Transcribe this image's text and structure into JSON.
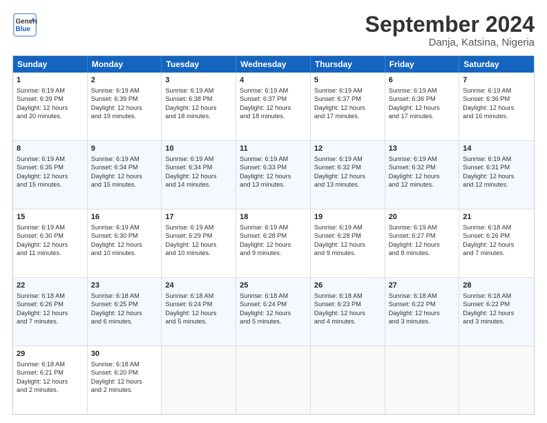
{
  "header": {
    "logo_line1": "General",
    "logo_line2": "Blue",
    "title": "September 2024",
    "subtitle": "Danja, Katsina, Nigeria"
  },
  "days": [
    "Sunday",
    "Monday",
    "Tuesday",
    "Wednesday",
    "Thursday",
    "Friday",
    "Saturday"
  ],
  "rows": [
    [
      {
        "num": "1",
        "lines": [
          "Sunrise: 6:19 AM",
          "Sunset: 6:39 PM",
          "Daylight: 12 hours",
          "and 20 minutes."
        ]
      },
      {
        "num": "2",
        "lines": [
          "Sunrise: 6:19 AM",
          "Sunset: 6:39 PM",
          "Daylight: 12 hours",
          "and 19 minutes."
        ]
      },
      {
        "num": "3",
        "lines": [
          "Sunrise: 6:19 AM",
          "Sunset: 6:38 PM",
          "Daylight: 12 hours",
          "and 18 minutes."
        ]
      },
      {
        "num": "4",
        "lines": [
          "Sunrise: 6:19 AM",
          "Sunset: 6:37 PM",
          "Daylight: 12 hours",
          "and 18 minutes."
        ]
      },
      {
        "num": "5",
        "lines": [
          "Sunrise: 6:19 AM",
          "Sunset: 6:37 PM",
          "Daylight: 12 hours",
          "and 17 minutes."
        ]
      },
      {
        "num": "6",
        "lines": [
          "Sunrise: 6:19 AM",
          "Sunset: 6:36 PM",
          "Daylight: 12 hours",
          "and 17 minutes."
        ]
      },
      {
        "num": "7",
        "lines": [
          "Sunrise: 6:19 AM",
          "Sunset: 6:36 PM",
          "Daylight: 12 hours",
          "and 16 minutes."
        ]
      }
    ],
    [
      {
        "num": "8",
        "lines": [
          "Sunrise: 6:19 AM",
          "Sunset: 6:35 PM",
          "Daylight: 12 hours",
          "and 15 minutes."
        ]
      },
      {
        "num": "9",
        "lines": [
          "Sunrise: 6:19 AM",
          "Sunset: 6:34 PM",
          "Daylight: 12 hours",
          "and 15 minutes."
        ]
      },
      {
        "num": "10",
        "lines": [
          "Sunrise: 6:19 AM",
          "Sunset: 6:34 PM",
          "Daylight: 12 hours",
          "and 14 minutes."
        ]
      },
      {
        "num": "11",
        "lines": [
          "Sunrise: 6:19 AM",
          "Sunset: 6:33 PM",
          "Daylight: 12 hours",
          "and 13 minutes."
        ]
      },
      {
        "num": "12",
        "lines": [
          "Sunrise: 6:19 AM",
          "Sunset: 6:32 PM",
          "Daylight: 12 hours",
          "and 13 minutes."
        ]
      },
      {
        "num": "13",
        "lines": [
          "Sunrise: 6:19 AM",
          "Sunset: 6:32 PM",
          "Daylight: 12 hours",
          "and 12 minutes."
        ]
      },
      {
        "num": "14",
        "lines": [
          "Sunrise: 6:19 AM",
          "Sunset: 6:31 PM",
          "Daylight: 12 hours",
          "and 12 minutes."
        ]
      }
    ],
    [
      {
        "num": "15",
        "lines": [
          "Sunrise: 6:19 AM",
          "Sunset: 6:30 PM",
          "Daylight: 12 hours",
          "and 11 minutes."
        ]
      },
      {
        "num": "16",
        "lines": [
          "Sunrise: 6:19 AM",
          "Sunset: 6:30 PM",
          "Daylight: 12 hours",
          "and 10 minutes."
        ]
      },
      {
        "num": "17",
        "lines": [
          "Sunrise: 6:19 AM",
          "Sunset: 6:29 PM",
          "Daylight: 12 hours",
          "and 10 minutes."
        ]
      },
      {
        "num": "18",
        "lines": [
          "Sunrise: 6:19 AM",
          "Sunset: 6:28 PM",
          "Daylight: 12 hours",
          "and 9 minutes."
        ]
      },
      {
        "num": "19",
        "lines": [
          "Sunrise: 6:19 AM",
          "Sunset: 6:28 PM",
          "Daylight: 12 hours",
          "and 9 minutes."
        ]
      },
      {
        "num": "20",
        "lines": [
          "Sunrise: 6:19 AM",
          "Sunset: 6:27 PM",
          "Daylight: 12 hours",
          "and 8 minutes."
        ]
      },
      {
        "num": "21",
        "lines": [
          "Sunrise: 6:18 AM",
          "Sunset: 6:26 PM",
          "Daylight: 12 hours",
          "and 7 minutes."
        ]
      }
    ],
    [
      {
        "num": "22",
        "lines": [
          "Sunrise: 6:18 AM",
          "Sunset: 6:26 PM",
          "Daylight: 12 hours",
          "and 7 minutes."
        ]
      },
      {
        "num": "23",
        "lines": [
          "Sunrise: 6:18 AM",
          "Sunset: 6:25 PM",
          "Daylight: 12 hours",
          "and 6 minutes."
        ]
      },
      {
        "num": "24",
        "lines": [
          "Sunrise: 6:18 AM",
          "Sunset: 6:24 PM",
          "Daylight: 12 hours",
          "and 5 minutes."
        ]
      },
      {
        "num": "25",
        "lines": [
          "Sunrise: 6:18 AM",
          "Sunset: 6:24 PM",
          "Daylight: 12 hours",
          "and 5 minutes."
        ]
      },
      {
        "num": "26",
        "lines": [
          "Sunrise: 6:18 AM",
          "Sunset: 6:23 PM",
          "Daylight: 12 hours",
          "and 4 minutes."
        ]
      },
      {
        "num": "27",
        "lines": [
          "Sunrise: 6:18 AM",
          "Sunset: 6:22 PM",
          "Daylight: 12 hours",
          "and 3 minutes."
        ]
      },
      {
        "num": "28",
        "lines": [
          "Sunrise: 6:18 AM",
          "Sunset: 6:22 PM",
          "Daylight: 12 hours",
          "and 3 minutes."
        ]
      }
    ],
    [
      {
        "num": "29",
        "lines": [
          "Sunrise: 6:18 AM",
          "Sunset: 6:21 PM",
          "Daylight: 12 hours",
          "and 2 minutes."
        ]
      },
      {
        "num": "30",
        "lines": [
          "Sunrise: 6:18 AM",
          "Sunset: 6:20 PM",
          "Daylight: 12 hours",
          "and 2 minutes."
        ]
      },
      {
        "num": "",
        "lines": []
      },
      {
        "num": "",
        "lines": []
      },
      {
        "num": "",
        "lines": []
      },
      {
        "num": "",
        "lines": []
      },
      {
        "num": "",
        "lines": []
      }
    ]
  ]
}
